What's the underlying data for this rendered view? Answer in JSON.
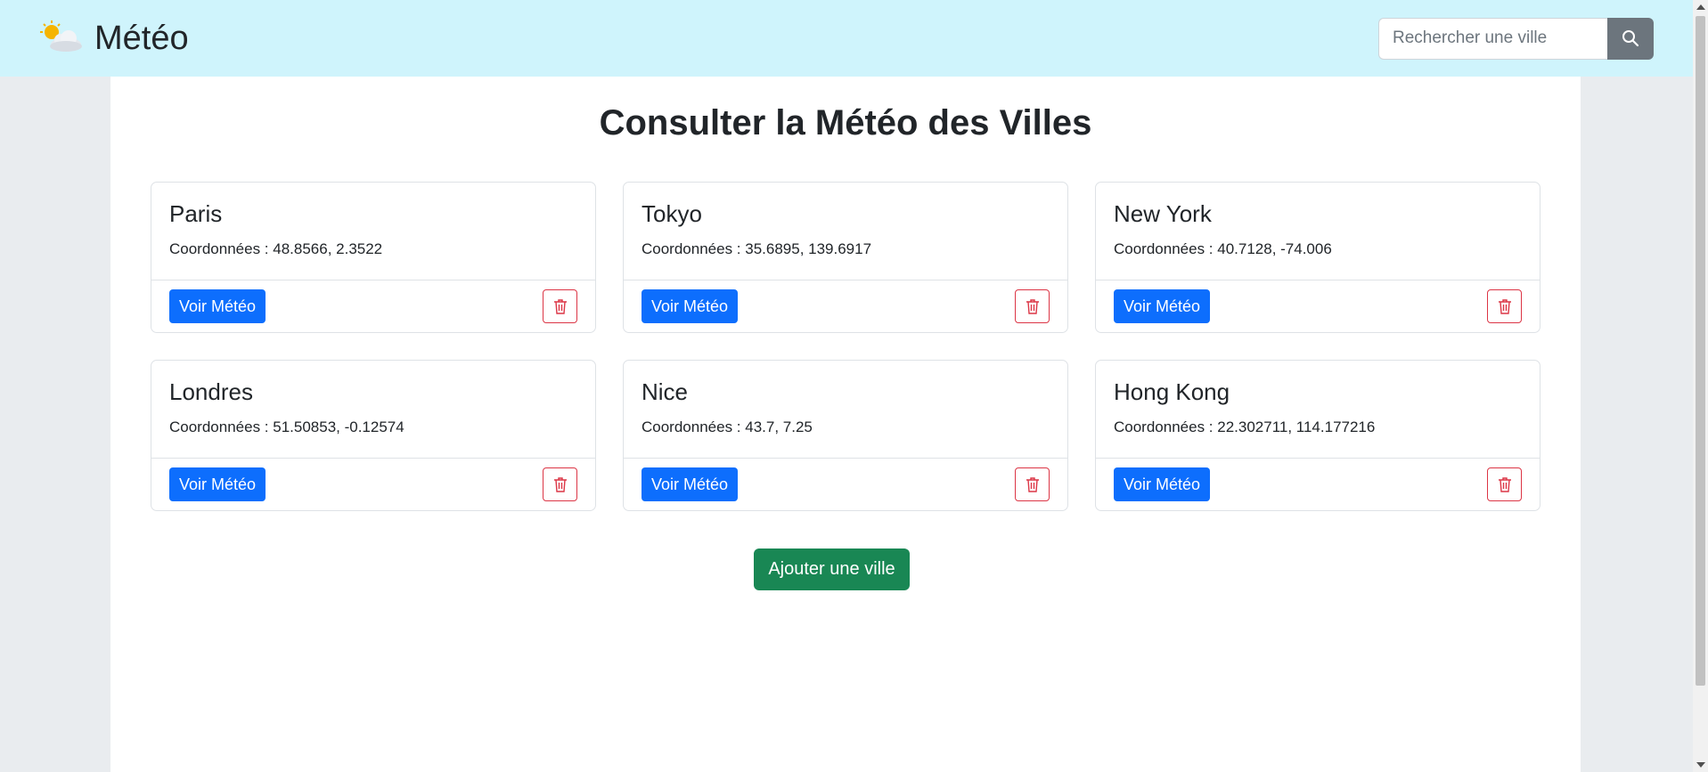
{
  "brand": {
    "title": "Météo",
    "icon": "sun-behind-cloud-icon"
  },
  "search": {
    "placeholder": "Rechercher une ville",
    "value": "",
    "icon": "search-icon"
  },
  "main": {
    "title": "Consulter la Météo des Villes",
    "cities": [
      {
        "name": "Paris",
        "coords": "Coordonnées : 48.8566, 2.3522",
        "action_label": "Voir Météo"
      },
      {
        "name": "Tokyo",
        "coords": "Coordonnées : 35.6895, 139.6917",
        "action_label": "Voir Météo"
      },
      {
        "name": "New York",
        "coords": "Coordonnées : 40.7128, -74.006",
        "action_label": "Voir Météo"
      },
      {
        "name": "Londres",
        "coords": "Coordonnées : 51.50853, -0.12574",
        "action_label": "Voir Météo"
      },
      {
        "name": "Nice",
        "coords": "Coordonnées : 43.7, 7.25",
        "action_label": "Voir Météo"
      },
      {
        "name": "Hong Kong",
        "coords": "Coordonnées : 22.302711, 114.177216",
        "action_label": "Voir Météo"
      }
    ],
    "add_label": "Ajouter une ville"
  },
  "colors": {
    "navbar": "#cff4fc",
    "primary": "#0d6efd",
    "success": "#198754",
    "danger": "#dc3545",
    "secondary": "#6c757d"
  }
}
